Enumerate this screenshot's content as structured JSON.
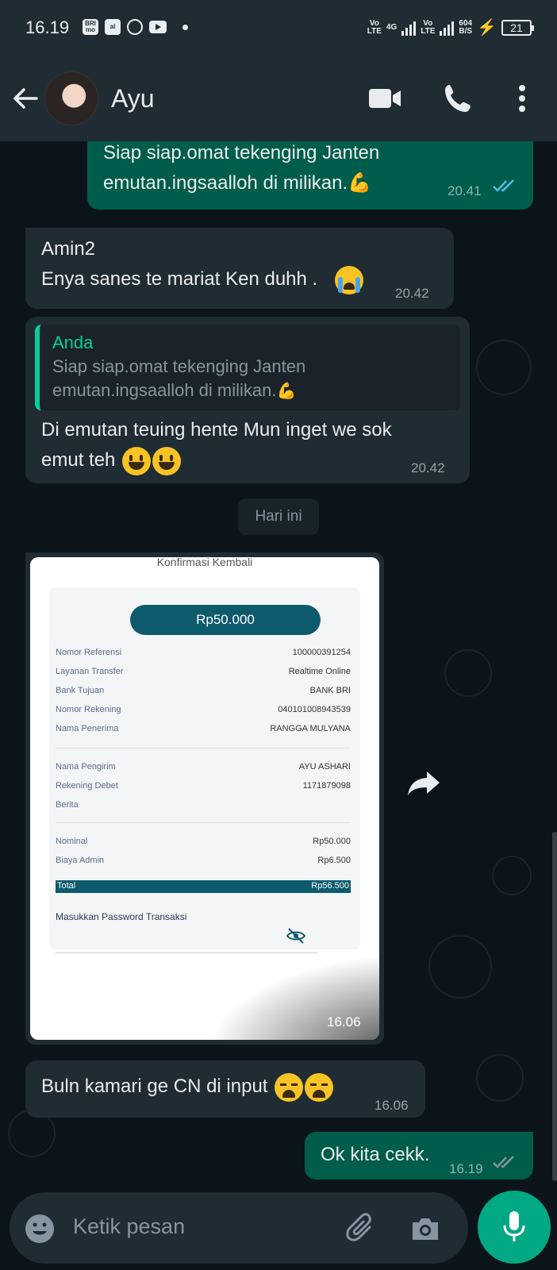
{
  "status_bar": {
    "time": "16.19",
    "left_icons": [
      "BRImo",
      "al",
      "whatsapp-icon",
      "youtube-icon",
      "dot"
    ],
    "net1": "Vo LTE",
    "net2": "4G",
    "net3": "Vo LTE",
    "speed": "604",
    "speed_unit": "B/S",
    "battery": "21"
  },
  "header": {
    "contact_name": "Ayu"
  },
  "messages": [
    {
      "type": "outgoing",
      "lines": [
        "Siap siap.omat tekenging Janten",
        "emutan.ingsaalloh di milikan."
      ],
      "emoji": "muscle",
      "time": "20.41",
      "status": "read"
    },
    {
      "type": "incoming",
      "lines": [
        "Amin2",
        "Enya sanes te mariat Ken duhh ."
      ],
      "emoji": "crying",
      "time": "20.42"
    },
    {
      "type": "outgoing-reply",
      "quote_author": "Anda",
      "quote_lines": [
        "Siap siap.omat tekenging Janten",
        "emutan.ingsaalloh di milikan."
      ],
      "lines": [
        "Di emutan teuing hente Mun inget we sok",
        "emut teh"
      ],
      "emoji": "grinning x2",
      "time": "20.42"
    },
    {
      "type": "day",
      "label": "Hari ini"
    },
    {
      "type": "incoming-image",
      "time": "16.06"
    },
    {
      "type": "incoming",
      "lines": [
        "Buln kamari ge CN di input"
      ],
      "emoji": "weary x2",
      "time": "16.06"
    },
    {
      "type": "outgoing",
      "lines": [
        "Ok kita cekk."
      ],
      "time": "16.19",
      "status": "delivered"
    }
  ],
  "receipt": {
    "title": "Konfirmasi Kembali",
    "amount": "Rp50.000",
    "rows": [
      {
        "label": "Nomor Referensi",
        "value": "100000391254"
      },
      {
        "label": "Layanan Transfer",
        "value": "Realtime Online"
      },
      {
        "label": "Bank Tujuan",
        "value": "BANK BRI"
      },
      {
        "label": "Nomor Rekening",
        "value": "040101008943539"
      },
      {
        "label": "Nama Penerima",
        "value": "RANGGA MULYANA"
      },
      {
        "label": "Nama Pengirim",
        "value": "AYU ASHARI"
      },
      {
        "label": "Rekening Debet",
        "value": "1171879098"
      },
      {
        "label": "Berita",
        "value": ""
      },
      {
        "label": "Nominal",
        "value": "Rp50.000"
      },
      {
        "label": "Biaya Admin",
        "value": "Rp6.500"
      }
    ],
    "total_label": "Total",
    "total_value": "Rp56.500",
    "password_label": "Masukkan Password Transaksi"
  },
  "input": {
    "placeholder": "Ketik pesan"
  },
  "colors": {
    "header_bg": "#1f2c34",
    "chat_bg": "#0b141a",
    "outgoing_bubble": "#005c4b",
    "incoming_bubble": "#202c33",
    "accent": "#00a884",
    "read_ticks": "#53bdeb"
  }
}
